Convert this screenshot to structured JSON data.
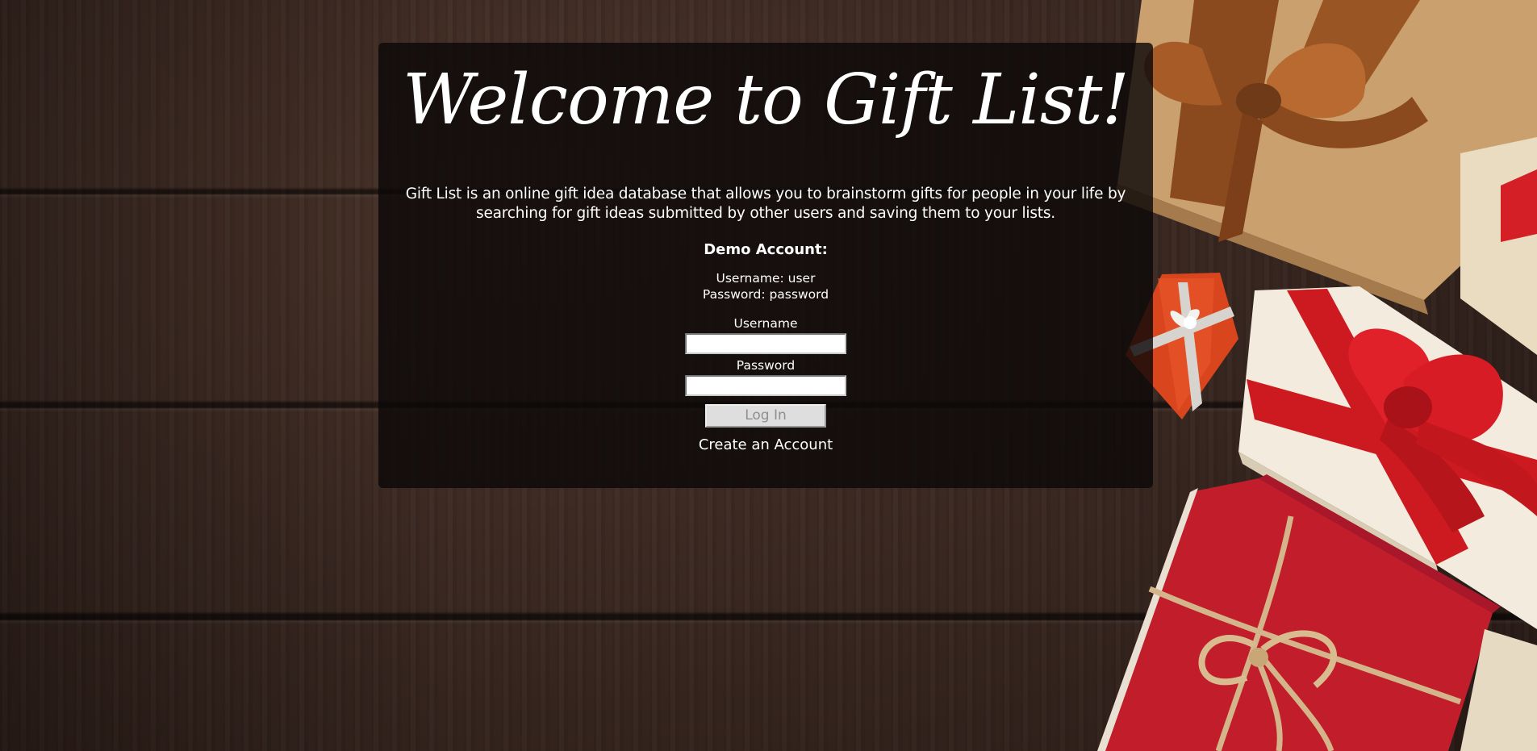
{
  "page": {
    "title": "Welcome to Gift List!",
    "description": "Gift List is an online gift idea database that allows you to brainstorm gifts for people in your life by searching for gift ideas submitted by other users and saving them to your lists."
  },
  "demo": {
    "heading": "Demo Account:",
    "username_line": "Username: user",
    "password_line": "Password: password"
  },
  "form": {
    "username_label": "Username",
    "username_value": "",
    "password_label": "Password",
    "password_value": "",
    "login_label": "Log In",
    "create_account_label": "Create an Account"
  },
  "background": {
    "scene": "wood-planks-with-gift-boxes",
    "wood_color": "#3a2820",
    "panel_color": "#0c0908",
    "gift_colors": [
      "#c48a4e",
      "#b5651d",
      "#cc1f1f",
      "#f2e9da",
      "#e0471f"
    ]
  }
}
